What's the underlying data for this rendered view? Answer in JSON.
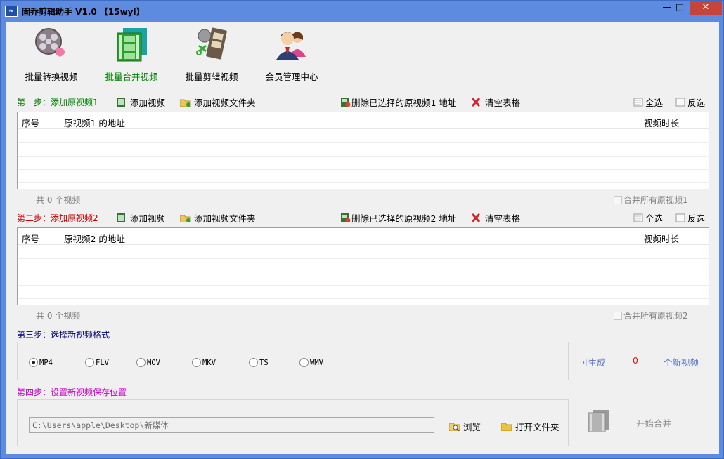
{
  "window": {
    "title": "固乔剪辑助手 V1.0  【15wyl】",
    "icon_text": "≈",
    "min": "—",
    "max": "□",
    "close": "✕"
  },
  "toolbar": [
    {
      "label": "批量转换视频",
      "icon": "film-reel-icon",
      "active": false
    },
    {
      "label": "批量合并视频",
      "icon": "film-strips-icon",
      "active": true
    },
    {
      "label": "批量剪辑视频",
      "icon": "film-cut-icon",
      "active": false
    },
    {
      "label": "会员管理中心",
      "icon": "members-icon",
      "active": false
    }
  ],
  "step1": {
    "label": "第一步：添加原视频1",
    "add_video": "添加视频",
    "add_folder": "添加视频文件夹",
    "delete_selected": "删除已选择的原视频1 地址",
    "clear_table": "清空表格",
    "select_all": "全选",
    "invert": "反选",
    "table": {
      "col_index": "序号",
      "col_path": "原视频1 的地址",
      "col_duration": "视频时长",
      "rows": []
    },
    "count_text": "共 0 个视频",
    "merge_all": "合并所有原视频1"
  },
  "step2": {
    "label": "第二步：添加原视频2",
    "add_video": "添加视频",
    "add_folder": "添加视频文件夹",
    "delete_selected": "删除已选择的原视频2 地址",
    "clear_table": "清空表格",
    "select_all": "全选",
    "invert": "反选",
    "table": {
      "col_index": "序号",
      "col_path": "原视频2 的地址",
      "col_duration": "视频时长",
      "rows": []
    },
    "count_text": "共 0 个视频",
    "merge_all": "合并所有原视频2"
  },
  "step3": {
    "label": "第三步：选择新视频格式",
    "formats": [
      {
        "label": "MP4",
        "selected": true
      },
      {
        "label": "FLV",
        "selected": false
      },
      {
        "label": "MOV",
        "selected": false
      },
      {
        "label": "MKV",
        "selected": false
      },
      {
        "label": "TS",
        "selected": false
      },
      {
        "label": "WMV",
        "selected": false
      }
    ],
    "can_generate": "可生成",
    "generate_count": "0",
    "new_videos": "个新视频"
  },
  "step4": {
    "label": "第四步：设置新视频保存位置",
    "save_path": "C:\\Users\\apple\\Desktop\\新媒体",
    "browse": "浏览",
    "open_folder": "打开文件夹",
    "start_merge": "开始合并"
  },
  "colors": {
    "step_green": "#008000",
    "step_red": "#cc0000",
    "step_blue": "#000080",
    "step_magenta": "#cc00cc",
    "title_bar": "#5d8be0",
    "close_button": "#c7443a"
  }
}
